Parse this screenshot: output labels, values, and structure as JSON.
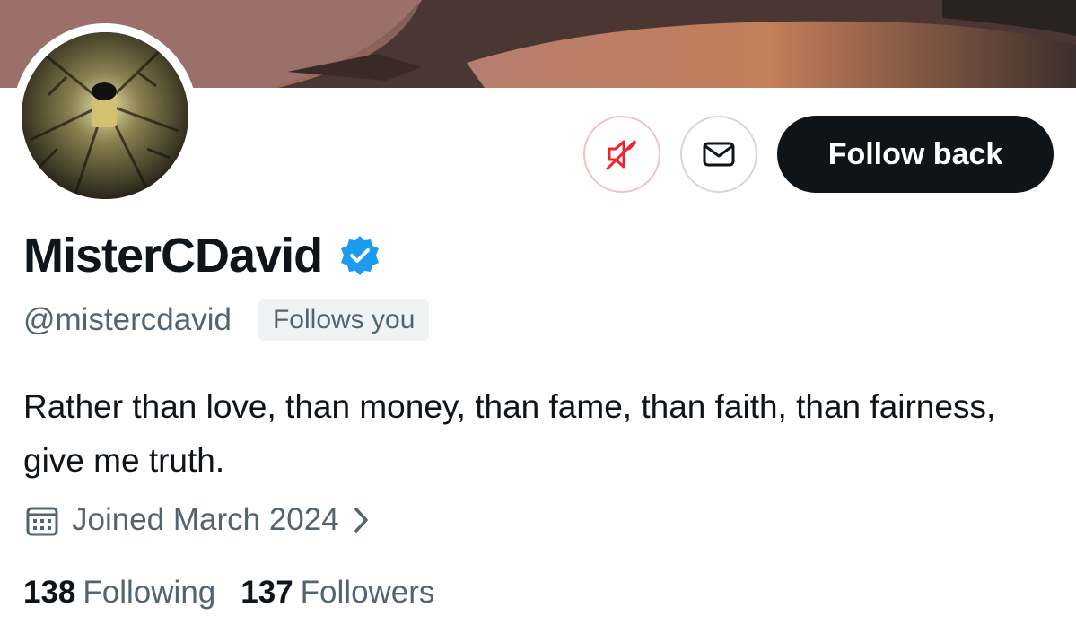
{
  "banner": {
    "image": "sunset-lake-photo"
  },
  "avatar": {
    "image": "lantern-shadow-photo"
  },
  "actions": {
    "mute_icon": "speaker-muted-icon",
    "message_icon": "envelope-icon",
    "follow_back_label": "Follow back"
  },
  "profile": {
    "display_name": "MisterCDavid",
    "verified_icon": "verified-badge-icon",
    "handle": "@mistercdavid",
    "follows_you_label": "Follows you",
    "bio": "Rather than love, than money, than fame, than faith, than fairness, give me truth.",
    "joined_icon": "calendar-icon",
    "joined_text": "Joined March 2024",
    "joined_chevron": "chevron-right-icon"
  },
  "stats": {
    "following_count": "138",
    "following_label": "Following",
    "followers_count": "137",
    "followers_label": "Followers"
  },
  "colors": {
    "text_primary": "#0f1419",
    "text_secondary": "#536471",
    "verified_blue": "#1d9bf0",
    "mute_red": "#f4212e",
    "badge_bg": "#eff3f4"
  }
}
